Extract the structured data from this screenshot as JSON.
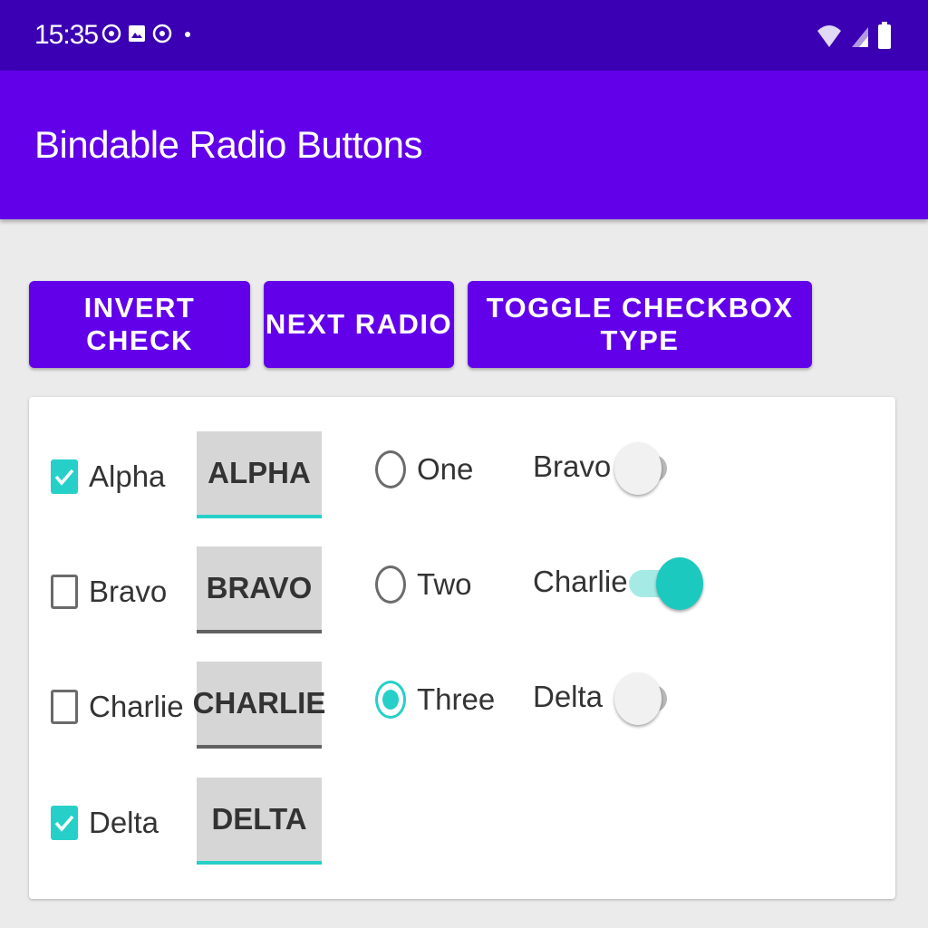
{
  "status_bar": {
    "time": "15:35",
    "left_icons": [
      "notification-icon",
      "photo-icon",
      "notification-icon",
      "dot-icon"
    ],
    "right_icons": [
      "wifi-icon",
      "signal-icon",
      "battery-icon"
    ]
  },
  "app_bar": {
    "title": "Bindable Radio Buttons"
  },
  "buttons": {
    "invert_check": "INVERT CHECK",
    "next_radio": "NEXT RADIO",
    "toggle_checkbox_type": "TOGGLE CHECKBOX TYPE"
  },
  "checkboxes": [
    {
      "label": "Alpha",
      "checked": true
    },
    {
      "label": "Bravo",
      "checked": false
    },
    {
      "label": "Charlie",
      "checked": false
    },
    {
      "label": "Delta",
      "checked": true
    }
  ],
  "toggle_buttons": [
    {
      "label": "ALPHA",
      "on": true
    },
    {
      "label": "BRAVO",
      "on": false
    },
    {
      "label": "CHARLIE",
      "on": false
    },
    {
      "label": "DELTA",
      "on": true
    }
  ],
  "radios": [
    {
      "label": "One",
      "selected": false
    },
    {
      "label": "Two",
      "selected": false
    },
    {
      "label": "Three",
      "selected": true
    }
  ],
  "switches": [
    {
      "label": "Bravo",
      "on": false
    },
    {
      "label": "Charlie",
      "on": true
    },
    {
      "label": "Delta",
      "on": false
    }
  ],
  "colors": {
    "status_bar": "#3b00b3",
    "primary": "#6200ea",
    "accent": "#26d0c8",
    "background": "#ebebeb"
  }
}
